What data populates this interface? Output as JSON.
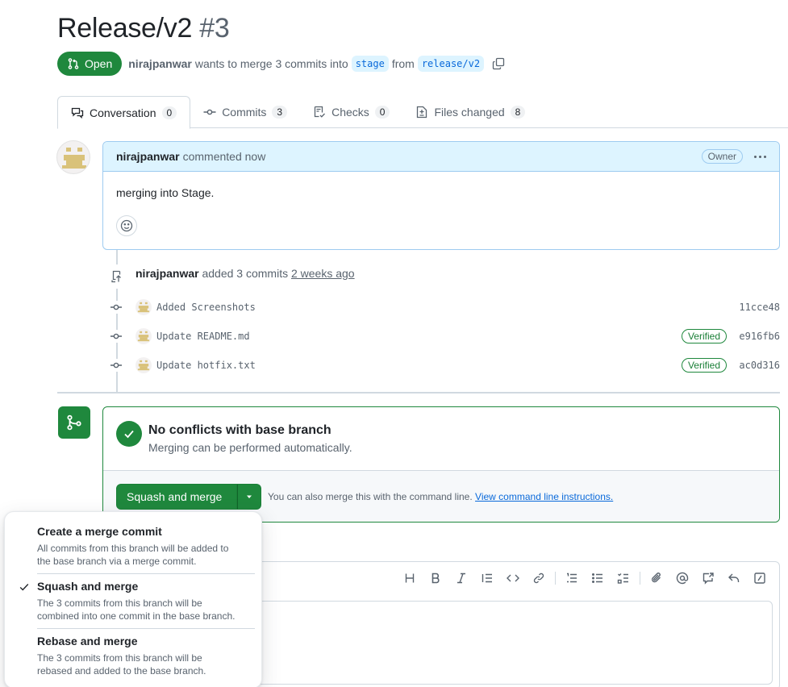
{
  "pr": {
    "title": "Release/v2",
    "number": "#3",
    "state": "Open",
    "author": "nirajpanwar",
    "merge_text": "wants to merge 3 commits into",
    "base_branch": "stage",
    "from_text": "from",
    "head_branch": "release/v2"
  },
  "tabs": [
    {
      "label": "Conversation",
      "count": "0"
    },
    {
      "label": "Commits",
      "count": "3"
    },
    {
      "label": "Checks",
      "count": "0"
    },
    {
      "label": "Files changed",
      "count": "8"
    }
  ],
  "comment": {
    "author": "nirajpanwar",
    "action": "commented now",
    "badge": "Owner",
    "body": "merging into Stage."
  },
  "push": {
    "author": "nirajpanwar",
    "text": "added 3 commits",
    "ago": "2 weeks ago"
  },
  "commits": [
    {
      "message": "Added Screenshots",
      "verified": "",
      "sha": "11cce48"
    },
    {
      "message": "Update README.md",
      "verified": "Verified",
      "sha": "e916fb6"
    },
    {
      "message": "Update hotfix.txt",
      "verified": "Verified",
      "sha": "ac0d316"
    }
  ],
  "merge": {
    "title": "No conflicts with base branch",
    "subtitle": "Merging can be performed automatically.",
    "button": "Squash and merge",
    "cli_text": "You can also merge this with the command line.",
    "cli_link": "View command line instructions."
  },
  "dropdown": [
    {
      "title": "Create a merge commit",
      "desc1": "All commits from this branch will be added to",
      "desc2": "the base branch via a merge commit.",
      "selected": false
    },
    {
      "title": "Squash and merge",
      "desc1": "The 3 commits from this branch will be",
      "desc2": "combined into one commit in the base branch.",
      "selected": true
    },
    {
      "title": "Rebase and merge",
      "desc1": "The 3 commits from this branch will be",
      "desc2": "rebased and added to the base branch.",
      "selected": false
    }
  ],
  "colors": {
    "success": "#1f883d",
    "link": "#0969da",
    "comment_header": "#ddf4ff"
  }
}
